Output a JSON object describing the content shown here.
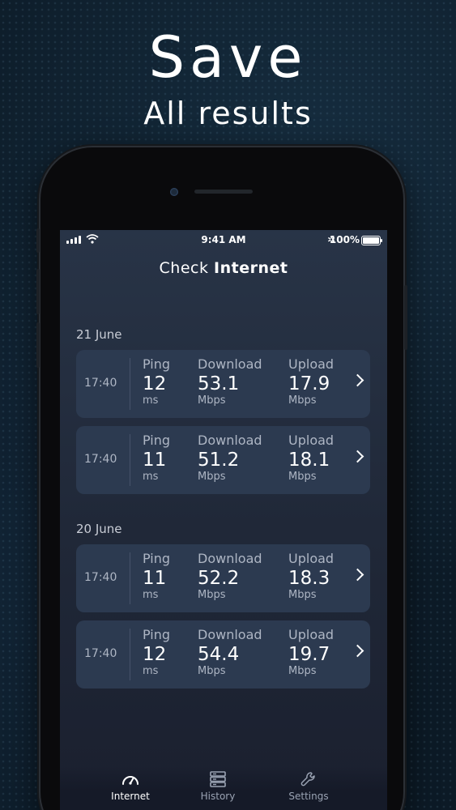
{
  "hero": {
    "title": "Save",
    "subtitle": "All results"
  },
  "status_bar": {
    "time": "9:41 AM",
    "battery": "100%"
  },
  "app": {
    "title_light": "Check",
    "title_bold": "Internet"
  },
  "groups": [
    {
      "date": "21 June",
      "results": [
        {
          "time": "17:40",
          "ping": "12",
          "download": "53.1",
          "upload": "17.9"
        },
        {
          "time": "17:40",
          "ping": "11",
          "download": "51.2",
          "upload": "18.1"
        }
      ]
    },
    {
      "date": "20 June",
      "results": [
        {
          "time": "17:40",
          "ping": "11",
          "download": "52.2",
          "upload": "18.3"
        },
        {
          "time": "17:40",
          "ping": "12",
          "download": "54.4",
          "upload": "19.7"
        }
      ]
    }
  ],
  "labels": {
    "ping": "Ping",
    "download": "Download",
    "upload": "Upload",
    "ms": "ms",
    "mbps": "Mbps"
  },
  "tabs": [
    {
      "label": "Internet",
      "icon": "speedometer-icon",
      "active": true
    },
    {
      "label": "History",
      "icon": "server-stack-icon",
      "active": false
    },
    {
      "label": "Settings",
      "icon": "wrench-icon",
      "active": false
    }
  ]
}
